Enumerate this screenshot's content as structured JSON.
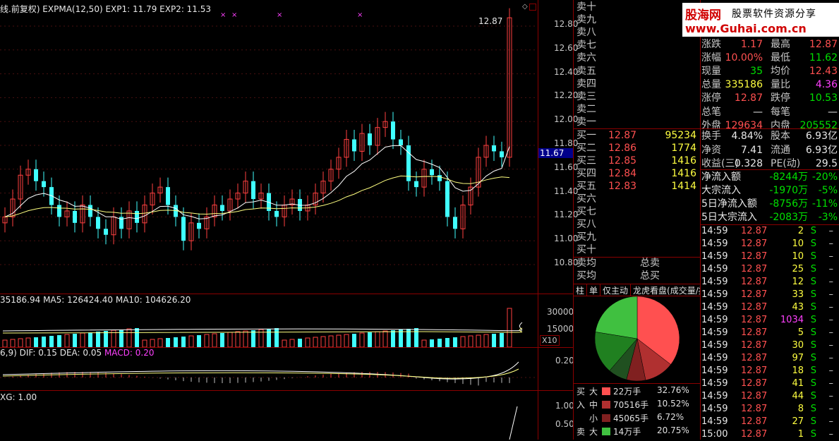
{
  "main_chart": {
    "header": "线.前复权) EXPMA(12,50) EXP1: 11.79 EXP2: 11.53",
    "peak_label": "12.87",
    "price_marker": "11.67",
    "y_ticks": [
      "12.80",
      "12.60",
      "12.40",
      "12.20",
      "12.00",
      "11.80",
      "11.60",
      "11.40",
      "11.20",
      "11.00",
      "10.80"
    ]
  },
  "volume_panel": {
    "header": "35186.94 MA5: 126424.40 MA10: 104626.20",
    "y_ticks": [
      "30000",
      "15000"
    ],
    "unit": "X10"
  },
  "macd_panel": {
    "header_prefix": "6,9) DIF: 0.15 DEA: 0.05",
    "header_macd": "MACD: 0.20",
    "y_ticks": [
      "0.20"
    ]
  },
  "xg_panel": {
    "header": "XG: 1.00",
    "y_ticks": [
      "1.00",
      "0.50"
    ]
  },
  "watermark": {
    "brand": "股海网",
    "slogan": "股票软件资源分享",
    "url": "www.Guhai.com.cn"
  },
  "order_book": {
    "sells": [
      {
        "label": "卖十"
      },
      {
        "label": "卖九"
      },
      {
        "label": "卖八"
      },
      {
        "label": "卖七"
      },
      {
        "label": "卖六"
      },
      {
        "label": "卖五"
      },
      {
        "label": "卖四"
      },
      {
        "label": "卖三"
      },
      {
        "label": "卖二"
      },
      {
        "label": "卖一"
      }
    ],
    "buys": [
      {
        "label": "买一",
        "price": "12.87",
        "volume": "95234"
      },
      {
        "label": "买二",
        "price": "12.86",
        "volume": "1774"
      },
      {
        "label": "买三",
        "price": "12.85",
        "volume": "1416"
      },
      {
        "label": "买四",
        "price": "12.84",
        "volume": "1416"
      },
      {
        "label": "买五",
        "price": "12.83",
        "volume": "1414"
      },
      {
        "label": "买六",
        "price": "",
        "volume": ""
      },
      {
        "label": "买七",
        "price": "",
        "volume": ""
      },
      {
        "label": "买八",
        "price": "",
        "volume": ""
      },
      {
        "label": "买九",
        "price": "",
        "volume": ""
      },
      {
        "label": "买十",
        "price": "",
        "volume": ""
      }
    ],
    "avg_sell_label": "卖均",
    "avg_buy_label": "买均",
    "total_sell_label": "总卖",
    "total_buy_label": "总买"
  },
  "tabs": [
    "柱",
    "单",
    "仅主动",
    "龙虎看盘(成交量/按"
  ],
  "pie_legend": [
    {
      "side": "买",
      "size": "大",
      "value": "22万手",
      "pct": "32.76%",
      "color": "#ff5050"
    },
    {
      "side": "入",
      "size": "中",
      "value": "70516手",
      "pct": "10.52%",
      "color": "#b03030"
    },
    {
      "side": "",
      "size": "小",
      "value": "45065手",
      "pct": "6.72%",
      "color": "#802020"
    },
    {
      "side": "卖",
      "size": "大",
      "value": "14万手",
      "pct": "20.75%",
      "color": "#40c040"
    }
  ],
  "pie_data": [
    {
      "name": "买大",
      "value": 32.76,
      "color": "#ff5050"
    },
    {
      "name": "买中",
      "value": 10.52,
      "color": "#b03030"
    },
    {
      "name": "买小",
      "value": 6.72,
      "color": "#802020"
    },
    {
      "name": "卖小",
      "value": 6.72,
      "color": "#205020"
    },
    {
      "name": "卖中",
      "value": 15.0,
      "color": "#208020"
    },
    {
      "name": "卖大",
      "value": 20.75,
      "color": "#40c040"
    }
  ],
  "quote": [
    {
      "l1": "涨跌",
      "v1": "1.17",
      "c1": "red",
      "l2": "最高",
      "v2": "12.87",
      "c2": "red"
    },
    {
      "l1": "涨幅",
      "v1": "10.00%",
      "c1": "red",
      "l2": "最低",
      "v2": "11.62",
      "c2": "green"
    },
    {
      "l1": "现量",
      "v1": "35",
      "c1": "green",
      "l2": "均价",
      "v2": "12.43",
      "c2": "red"
    },
    {
      "l1": "总量",
      "v1": "335186",
      "c1": "yellow",
      "l2": "量比",
      "v2": "4.36",
      "c2": "magenta"
    },
    {
      "l1": "涨停",
      "v1": "12.87",
      "c1": "red",
      "l2": "跌停",
      "v2": "10.53",
      "c2": "green"
    },
    {
      "l1": "总笔",
      "v1": "—",
      "c1": "white",
      "l2": "每笔",
      "v2": "—",
      "c2": "white"
    },
    {
      "l1": "外盘",
      "v1": "129634",
      "c1": "red",
      "l2": "内盘",
      "v2": "205552",
      "c2": "green"
    },
    {
      "l1": "换手",
      "v1": "4.84%",
      "c1": "white",
      "l2": "股本",
      "v2": "6.93亿",
      "c2": "white"
    },
    {
      "l1": "净资",
      "v1": "7.41",
      "c1": "white",
      "l2": "流通",
      "v2": "6.93亿",
      "c2": "white"
    },
    {
      "l1": "收益(三)",
      "v1": "0.328",
      "c1": "white",
      "l2": "PE(动)",
      "v2": "29.5",
      "c2": "white"
    }
  ],
  "flows": [
    {
      "label": "净流入额",
      "value": "-8244万",
      "pct": "-20%"
    },
    {
      "label": "大宗流入",
      "value": "-1970万",
      "pct": "-5%"
    },
    {
      "label": "5日净流入额",
      "value": "-8756万",
      "pct": "-11%"
    },
    {
      "label": "5日大宗流入",
      "value": "-2083万",
      "pct": "-3%"
    }
  ],
  "ticks": [
    {
      "time": "14:59",
      "price": "12.87",
      "vol": "2",
      "vc": "yellow",
      "bs": "S"
    },
    {
      "time": "14:59",
      "price": "12.87",
      "vol": "10",
      "vc": "yellow",
      "bs": "S"
    },
    {
      "time": "14:59",
      "price": "12.87",
      "vol": "10",
      "vc": "yellow",
      "bs": "S"
    },
    {
      "time": "14:59",
      "price": "12.87",
      "vol": "25",
      "vc": "yellow",
      "bs": "S"
    },
    {
      "time": "14:59",
      "price": "12.87",
      "vol": "12",
      "vc": "yellow",
      "bs": "S"
    },
    {
      "time": "14:59",
      "price": "12.87",
      "vol": "33",
      "vc": "yellow",
      "bs": "S"
    },
    {
      "time": "14:59",
      "price": "12.87",
      "vol": "43",
      "vc": "yellow",
      "bs": "S"
    },
    {
      "time": "14:59",
      "price": "12.87",
      "vol": "1034",
      "vc": "magenta",
      "bs": "S"
    },
    {
      "time": "14:59",
      "price": "12.87",
      "vol": "5",
      "vc": "yellow",
      "bs": "S"
    },
    {
      "time": "14:59",
      "price": "12.87",
      "vol": "30",
      "vc": "yellow",
      "bs": "S"
    },
    {
      "time": "14:59",
      "price": "12.87",
      "vol": "97",
      "vc": "yellow",
      "bs": "S"
    },
    {
      "time": "14:59",
      "price": "12.87",
      "vol": "18",
      "vc": "yellow",
      "bs": "S"
    },
    {
      "time": "14:59",
      "price": "12.87",
      "vol": "41",
      "vc": "yellow",
      "bs": "S"
    },
    {
      "time": "14:59",
      "price": "12.87",
      "vol": "44",
      "vc": "yellow",
      "bs": "S"
    },
    {
      "time": "14:59",
      "price": "12.87",
      "vol": "8",
      "vc": "yellow",
      "bs": "S"
    },
    {
      "time": "14:59",
      "price": "12.87",
      "vol": "27",
      "vc": "yellow",
      "bs": "S"
    },
    {
      "time": "15:00",
      "price": "12.87",
      "vol": "1",
      "vc": "yellow",
      "bs": "S"
    }
  ],
  "chart_data": {
    "type": "candlestick",
    "ylim": [
      10.7,
      12.9
    ],
    "close_series_approx": [
      11.2,
      11.35,
      11.55,
      11.6,
      11.5,
      11.45,
      11.3,
      11.2,
      11.25,
      11.15,
      11.3,
      11.2,
      11.1,
      11.05,
      11.2,
      11.1,
      11.25,
      11.15,
      11.3,
      11.4,
      11.45,
      11.3,
      11.2,
      11.0,
      11.15,
      11.1,
      11.2,
      11.3,
      11.25,
      11.35,
      11.4,
      11.5,
      11.35,
      11.4,
      11.25,
      11.2,
      11.3,
      11.35,
      11.25,
      11.3,
      11.4,
      11.5,
      11.6,
      11.7,
      11.85,
      11.75,
      11.9,
      11.8,
      11.95,
      12.0,
      11.85,
      11.8,
      11.5,
      11.45,
      11.6,
      11.55,
      11.5,
      11.2,
      11.1,
      11.3,
      11.45,
      11.7,
      11.8,
      11.75,
      11.7,
      12.87
    ],
    "ema1_label": "EXP1: 11.79",
    "ema2_label": "EXP2: 11.53"
  }
}
